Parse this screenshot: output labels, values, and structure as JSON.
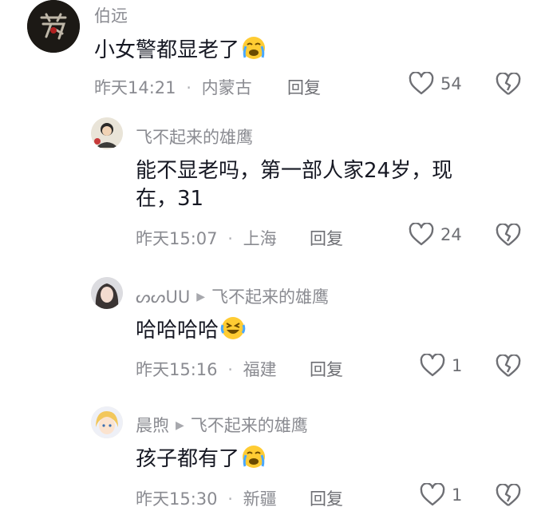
{
  "comments": [
    {
      "username": "伯远",
      "text": "小女警都显老了",
      "time": "昨天14:21",
      "location": "内蒙古",
      "reply": "回复",
      "likes": "54",
      "emoji": "crying-face"
    },
    {
      "username": "飞不起来的雄鹰",
      "text_line1": "能不显老吗，第一部人家24岁，现",
      "text_line2": "在，31",
      "time": "昨天15:07",
      "location": "上海",
      "reply": "回复",
      "likes": "24"
    },
    {
      "username": "ᔕᔕUU",
      "reply_to": "飞不起来的雄鹰",
      "text": "哈哈哈哈",
      "time": "昨天15:16",
      "location": "福建",
      "reply": "回复",
      "likes": "1",
      "emoji": "rolling-laughing-face"
    },
    {
      "username": "晨煦",
      "reply_to": "飞不起来的雄鹰",
      "text": "孩子都有了",
      "time": "昨天15:30",
      "location": "新疆",
      "reply": "回复",
      "likes": "1",
      "emoji": "crying-face"
    }
  ],
  "separator": "·",
  "colors": {
    "text": "#161823",
    "muted": "#8a8b91",
    "icon": "#6e6f74"
  }
}
